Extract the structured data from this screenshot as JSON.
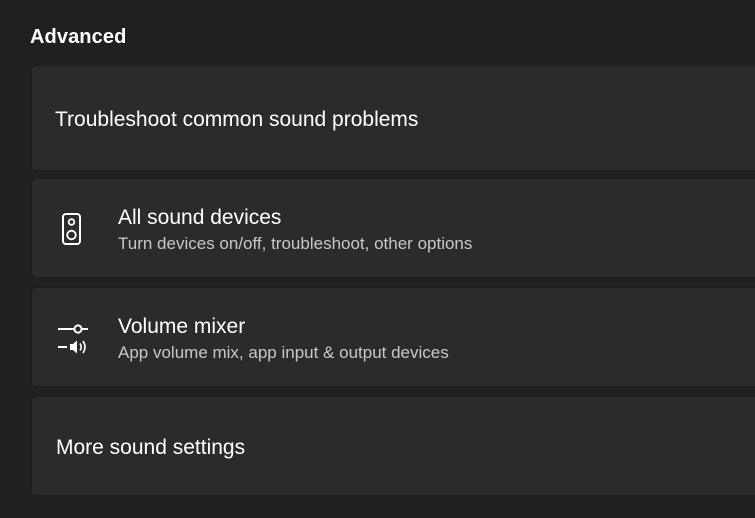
{
  "section": {
    "title": "Advanced"
  },
  "cards": {
    "troubleshoot": {
      "label": "Troubleshoot common sound problems"
    },
    "all_sound_devices": {
      "title": "All sound devices",
      "subtitle": "Turn devices on/off, troubleshoot, other options",
      "icon": "speaker-icon"
    },
    "volume_mixer": {
      "title": "Volume mixer",
      "subtitle": "App volume mix, app input & output devices",
      "icon": "volume-mixer-icon"
    },
    "more_sound_settings": {
      "label": "More sound settings"
    }
  },
  "colors": {
    "background": "#202020",
    "card": "#2b2b2b",
    "text": "#ffffff",
    "subtext": "#c8c8c8"
  }
}
